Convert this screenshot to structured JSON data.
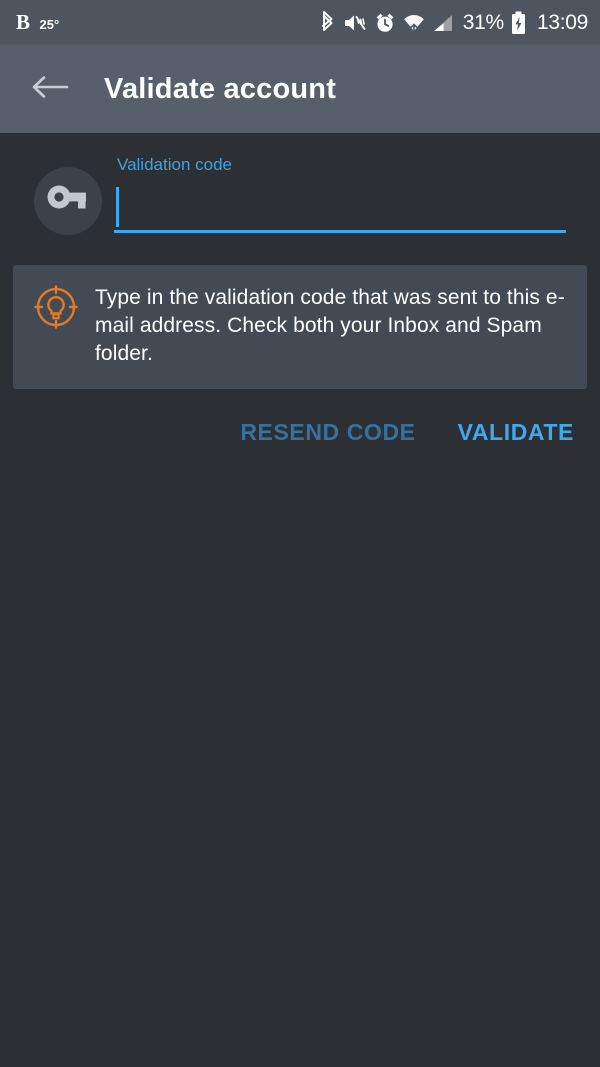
{
  "status_bar": {
    "weather_letter": "B",
    "temperature": "25°",
    "battery_percent": "31%",
    "clock": "13:09",
    "icons": [
      "bluetooth-icon",
      "mute-vibrate-icon",
      "alarm-clock-icon",
      "wifi-icon",
      "cellular-signal-icon",
      "battery-charging-icon"
    ],
    "colors": {
      "background": "#4e555f",
      "foreground": "#ffffff"
    }
  },
  "app_bar": {
    "back_icon": "back-arrow-icon",
    "title": "Validate account",
    "colors": {
      "background": "#575f6a",
      "title": "#ffffff"
    }
  },
  "form": {
    "avatar_icon": "key-icon",
    "field_label": "Validation code",
    "field_value": "",
    "field_placeholder": "",
    "accent_color": "#3fa9ef"
  },
  "info_card": {
    "icon": "lightbulb-idea-icon",
    "icon_color": "#e07b2a",
    "text": "Type in the validation code that was sent to this e-mail address. Check both your Inbox and Spam folder.",
    "background": "#434a53"
  },
  "actions": {
    "resend_label": "RESEND CODE",
    "resend_color": "#36719f",
    "validate_label": "VALIDATE",
    "validate_color": "#3fa9ef"
  },
  "page": {
    "background": "#2c2f34"
  }
}
